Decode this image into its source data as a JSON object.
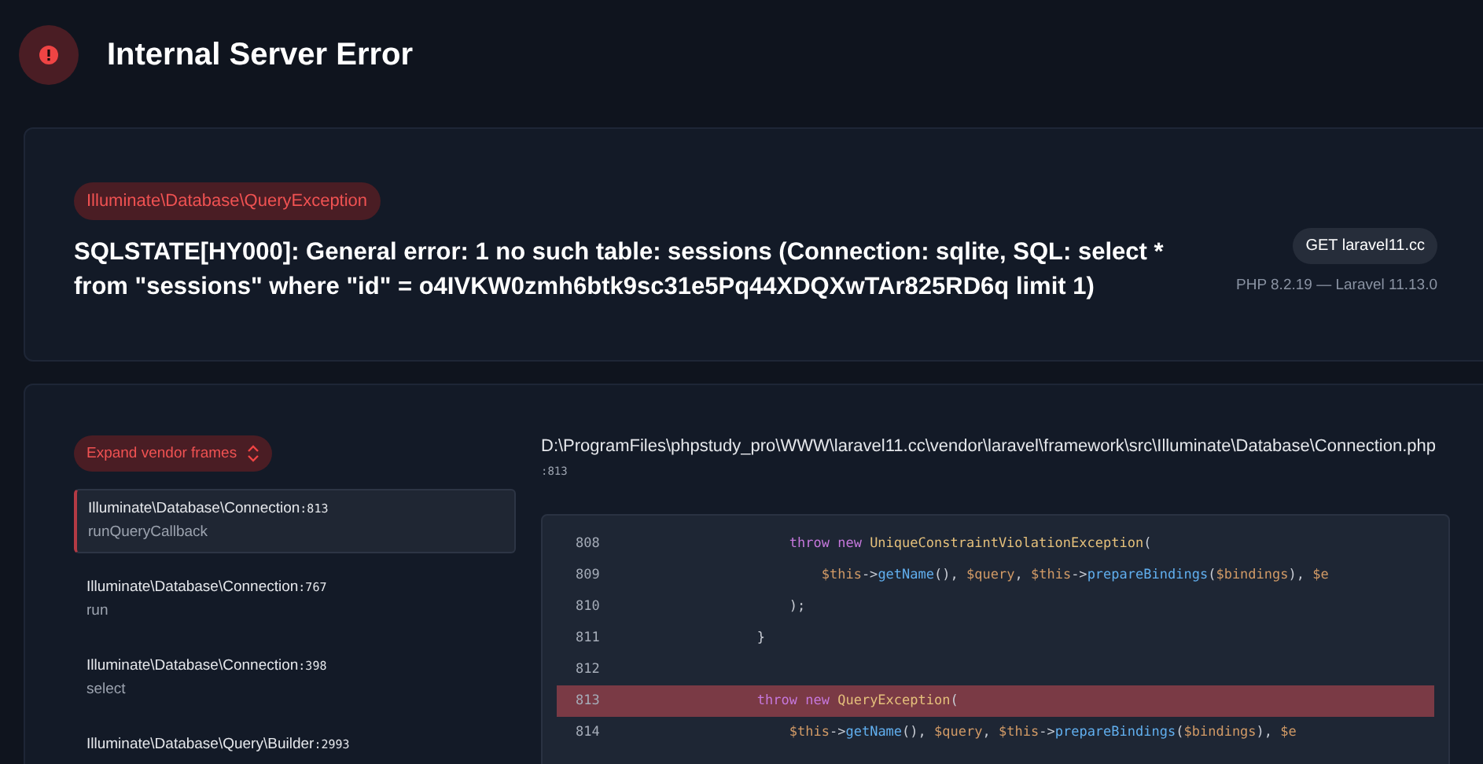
{
  "page": {
    "title": "Internal Server Error"
  },
  "exception": {
    "class": "Illuminate\\Database\\QueryException",
    "message": "SQLSTATE[HY000]: General error: 1 no such table: sessions (Connection: sqlite, SQL: select * from \"sessions\" where \"id\" = o4IVKW0zmh6btk9sc31e5Pq44XDQXwTAr825RD6q limit 1)",
    "request": "GET laravel11.cc",
    "versions": "PHP 8.2.19 — Laravel 11.13.0"
  },
  "trace": {
    "expand_button": "Expand vendor frames",
    "frames": [
      {
        "class": "Illuminate\\Database\\Connection",
        "line": ":813",
        "method": "runQueryCallback",
        "selected": true
      },
      {
        "class": "Illuminate\\Database\\Connection",
        "line": ":767",
        "method": "run",
        "selected": false
      },
      {
        "class": "Illuminate\\Database\\Connection",
        "line": ":398",
        "method": "select",
        "selected": false
      },
      {
        "class": "Illuminate\\Database\\Query\\Builder",
        "line": ":2993",
        "selected": false
      }
    ],
    "file": "D:\\ProgramFiles\\phpstudy_pro\\WWW\\laravel11.cc\\vendor\\laravel\\framework\\src\\Illuminate\\Database\\Connection.php",
    "file_line": ":813",
    "code": [
      {
        "number": "808",
        "highlighted": false,
        "tokens": [
          {
            "kind": "keyword",
            "text": "                throw new "
          },
          {
            "kind": "class",
            "text": "UniqueConstraintViolationException"
          },
          {
            "kind": "plain",
            "text": "("
          }
        ]
      },
      {
        "number": "809",
        "highlighted": false,
        "tokens": [
          {
            "kind": "var",
            "text": "                    $this"
          },
          {
            "kind": "plain",
            "text": "->"
          },
          {
            "kind": "method",
            "text": "getName"
          },
          {
            "kind": "plain",
            "text": "(), "
          },
          {
            "kind": "var",
            "text": "$query"
          },
          {
            "kind": "plain",
            "text": ", "
          },
          {
            "kind": "var",
            "text": "$this"
          },
          {
            "kind": "plain",
            "text": "->"
          },
          {
            "kind": "method",
            "text": "prepareBindings"
          },
          {
            "kind": "plain",
            "text": "("
          },
          {
            "kind": "var",
            "text": "$bindings"
          },
          {
            "kind": "plain",
            "text": "), "
          },
          {
            "kind": "var",
            "text": "$e"
          }
        ]
      },
      {
        "number": "810",
        "highlighted": false,
        "tokens": [
          {
            "kind": "plain",
            "text": "                );"
          }
        ]
      },
      {
        "number": "811",
        "highlighted": false,
        "tokens": [
          {
            "kind": "plain",
            "text": "            }"
          }
        ]
      },
      {
        "number": "812",
        "highlighted": false
      },
      {
        "number": "813",
        "highlighted": true,
        "tokens": [
          {
            "kind": "keyword",
            "text": "            throw new "
          },
          {
            "kind": "class",
            "text": "QueryException"
          },
          {
            "kind": "plain",
            "text": "("
          }
        ]
      },
      {
        "number": "814",
        "highlighted": false,
        "tokens": [
          {
            "kind": "var",
            "text": "                $this"
          },
          {
            "kind": "plain",
            "text": "->"
          },
          {
            "kind": "method",
            "text": "getName"
          },
          {
            "kind": "plain",
            "text": "(), "
          },
          {
            "kind": "var",
            "text": "$query"
          },
          {
            "kind": "plain",
            "text": ", "
          },
          {
            "kind": "var",
            "text": "$this"
          },
          {
            "kind": "plain",
            "text": "->"
          },
          {
            "kind": "method",
            "text": "prepareBindings"
          },
          {
            "kind": "plain",
            "text": "("
          },
          {
            "kind": "var",
            "text": "$bindings"
          },
          {
            "kind": "plain",
            "text": "), "
          },
          {
            "kind": "var",
            "text": "$e"
          }
        ]
      }
    ]
  }
}
